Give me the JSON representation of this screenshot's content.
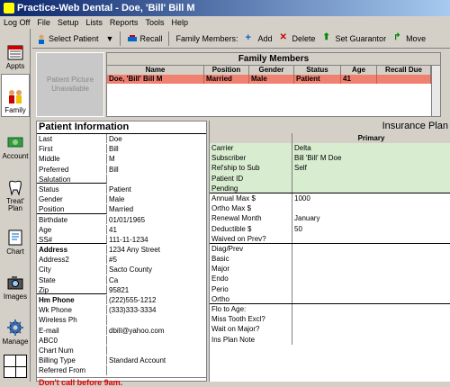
{
  "app": {
    "title": "Practice-Web Dental - Doe, 'Bill' Bill M"
  },
  "menu": [
    "Log Off",
    "File",
    "Setup",
    "Lists",
    "Reports",
    "Tools",
    "Help"
  ],
  "sidebar": {
    "items": [
      {
        "label": "Appts",
        "icon": "calendar-icon"
      },
      {
        "label": "Family",
        "icon": "family-icon",
        "active": true
      },
      {
        "label": "Account",
        "icon": "money-icon"
      },
      {
        "label": "Treat' Plan",
        "icon": "tooth-icon"
      },
      {
        "label": "Chart",
        "icon": "chart-icon"
      },
      {
        "label": "Images",
        "icon": "camera-icon"
      },
      {
        "label": "Manage",
        "icon": "gear-icon"
      }
    ]
  },
  "toolbar": {
    "select_patient": "Select Patient",
    "recall": "Recall",
    "family_members_label": "Family Members:",
    "add": "Add",
    "delete": "Delete",
    "set_guarantor": "Set Guarantor",
    "move": "Move"
  },
  "picture": {
    "text": "Patient Picture Unavailable"
  },
  "family": {
    "title": "Family Members",
    "columns": [
      "Name",
      "Position",
      "Gender",
      "Status",
      "Age",
      "Recall Due"
    ],
    "rows": [
      {
        "name": "Doe, 'Bill' Bill M",
        "position": "Married",
        "gender": "Male",
        "status": "Patient",
        "age": "41",
        "recall_due": ""
      }
    ]
  },
  "patient_info": {
    "title": "Patient Information",
    "rows": [
      {
        "label": "Last",
        "value": "Doe"
      },
      {
        "label": "First",
        "value": "Bill"
      },
      {
        "label": "Middle",
        "value": "M"
      },
      {
        "label": "Preferred",
        "value": "Bill"
      },
      {
        "label": "Salutation",
        "value": ""
      },
      {
        "label": "Status",
        "value": "Patient"
      },
      {
        "label": "Gender",
        "value": "Male"
      },
      {
        "label": "Position",
        "value": "Married"
      },
      {
        "label": "Birthdate",
        "value": "01/01/1965"
      },
      {
        "label": "Age",
        "value": "41"
      },
      {
        "label": "SS#",
        "value": "111-11-1234"
      },
      {
        "label": "Address",
        "value": "1234 Any Street"
      },
      {
        "label": "Address2",
        "value": "#5"
      },
      {
        "label": "City",
        "value": "Sacto County"
      },
      {
        "label": "State",
        "value": "Ca"
      },
      {
        "label": "Zip",
        "value": "95821"
      },
      {
        "label": "Hm Phone",
        "value": "(222)555-1212"
      },
      {
        "label": "Wk Phone",
        "value": "(333)333-3334"
      },
      {
        "label": "Wireless Ph",
        "value": ""
      },
      {
        "label": "E-mail",
        "value": "dbill@yahoo.com"
      },
      {
        "label": "ABC0",
        "value": ""
      },
      {
        "label": "Chart Num",
        "value": ""
      },
      {
        "label": "Billing Type",
        "value": "Standard Account"
      },
      {
        "label": "Referred From",
        "value": ""
      }
    ],
    "note": "Don't call before 9am."
  },
  "insurance": {
    "title": "Insurance Plan",
    "primary_header": "Primary",
    "rows": [
      {
        "label": "Carrier",
        "value": "Delta"
      },
      {
        "label": "Subscriber",
        "value": "Bill 'Bill' M Doe"
      },
      {
        "label": "Rel'ship to Sub",
        "value": "Self"
      },
      {
        "label": "Patient ID",
        "value": ""
      },
      {
        "label": "Pending",
        "value": ""
      },
      {
        "label": "Annual Max $",
        "value": "1000"
      },
      {
        "label": "Ortho Max $",
        "value": ""
      },
      {
        "label": "Renewal Month",
        "value": "January"
      },
      {
        "label": "Deductible $",
        "value": "50"
      },
      {
        "label": "Waived on Prev?",
        "value": ""
      },
      {
        "label": "Diag/Prev",
        "value": ""
      },
      {
        "label": "Basic",
        "value": ""
      },
      {
        "label": "Major",
        "value": ""
      },
      {
        "label": "Endo",
        "value": ""
      },
      {
        "label": "Perio",
        "value": ""
      },
      {
        "label": "Ortho",
        "value": ""
      },
      {
        "label": "Flo to Age:",
        "value": ""
      },
      {
        "label": "Miss Tooth Excl?",
        "value": ""
      },
      {
        "label": "Wait on Major?",
        "value": ""
      },
      {
        "label": "Ins Plan Note",
        "value": ""
      }
    ]
  }
}
